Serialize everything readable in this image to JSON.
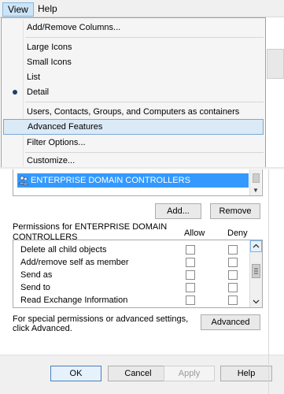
{
  "menubar": {
    "view_label": "View",
    "help_label": "Help"
  },
  "view_menu": {
    "items": [
      {
        "label": "Add/Remove Columns..."
      },
      {
        "label": "Large Icons"
      },
      {
        "label": "Small Icons"
      },
      {
        "label": "List"
      },
      {
        "label": "Detail",
        "selected": true
      },
      {
        "label": "Users, Contacts, Groups, and Computers as containers"
      },
      {
        "label": "Advanced Features",
        "highlighted": true
      },
      {
        "label": "Filter Options..."
      },
      {
        "label": "Customize..."
      }
    ]
  },
  "security": {
    "selected_principal": "ENTERPRISE DOMAIN CONTROLLERS",
    "add_label": "Add...",
    "remove_label": "Remove",
    "permissions_for": "Permissions for ENTERPRISE DOMAIN CONTROLLERS",
    "allow_header": "Allow",
    "deny_header": "Deny",
    "permissions": [
      {
        "name": "Delete all child objects"
      },
      {
        "name": "Add/remove self as member"
      },
      {
        "name": "Send as"
      },
      {
        "name": "Send to"
      },
      {
        "name": "Read Exchange Information"
      }
    ],
    "special_text": "For special permissions or advanced settings, click Advanced.",
    "advanced_label": "Advanced"
  },
  "footer": {
    "ok_label": "OK",
    "cancel_label": "Cancel",
    "apply_label": "Apply",
    "help_label": "Help"
  },
  "colors": {
    "selection": "#3399ff",
    "menu_highlight": "#dbeaf7"
  }
}
